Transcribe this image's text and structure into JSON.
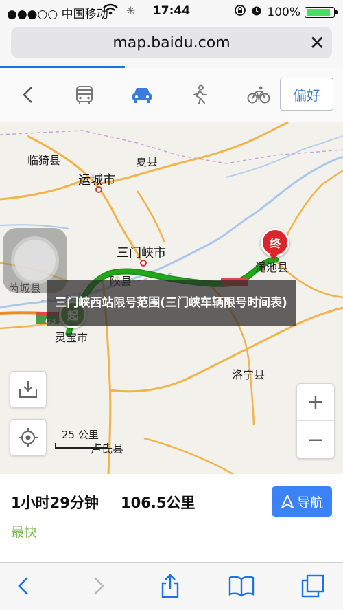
{
  "status": {
    "carrier": "●●●○○ 中国移动",
    "time": "17:44",
    "battery": "100%"
  },
  "browser": {
    "url": "map.baidu.com",
    "close": "✕"
  },
  "transport": {
    "preference_label": "偏好",
    "modes": [
      "bus",
      "car",
      "walk",
      "bike"
    ],
    "active_mode": "car"
  },
  "map": {
    "places": {
      "linyi": "临猗县",
      "xiaxian": "夏县",
      "yuncheng": "运城市",
      "sanmenxia": "三门峡市",
      "ruicheng": "芮城县",
      "shanxian": "陕县",
      "mianchi": "渑池县",
      "lingbao": "灵宝市",
      "luoning": "洛宁县",
      "lushi": "卢氏县"
    },
    "start_marker": "起",
    "end_marker": "终",
    "road_badge": "G3",
    "overlay_title": "三门峡西站限号范围(三门峡车辆限号时间表)",
    "scale_label": "25 公里",
    "zoom_in": "+",
    "zoom_out": "−",
    "route_color": "#1fa81a"
  },
  "route": {
    "duration": "1小时29分钟",
    "distance": "106.5公里",
    "tag": "最快",
    "nav_label": "导航"
  }
}
